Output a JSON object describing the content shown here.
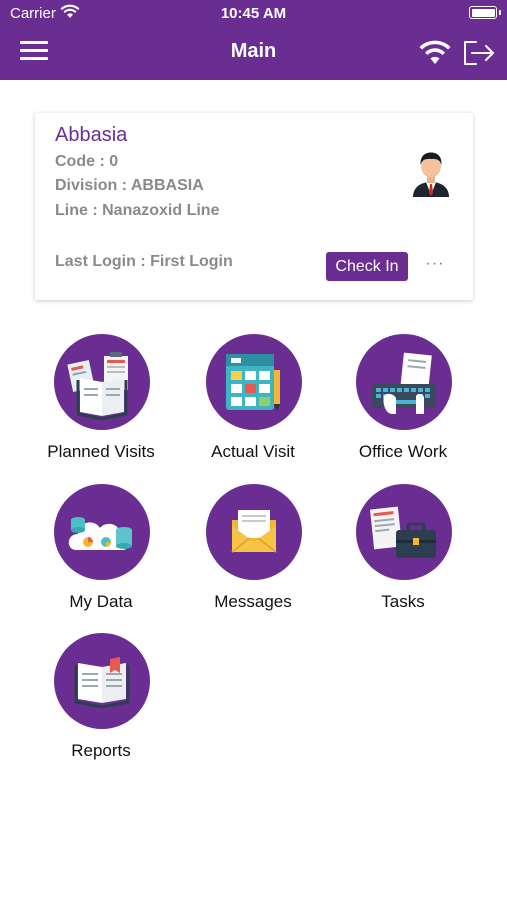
{
  "status_bar": {
    "carrier": "Carrier",
    "time": "10:45 AM"
  },
  "nav": {
    "title": "Main",
    "icons": [
      "menu-icon",
      "wifi-icon",
      "logout-icon"
    ]
  },
  "profile": {
    "name": "Abbasia",
    "code": "Code : 0",
    "division": "Division : ABBASIA",
    "line": "Line : Nanazoxid Line",
    "last_login": "Last Login : First Login",
    "check_in_label": "Check In",
    "more_label": "···",
    "avatar_icon": "businessman-avatar-icon"
  },
  "tiles": [
    {
      "label": "Planned Visits",
      "icon": "planned-visits-icon"
    },
    {
      "label": "Actual Visit",
      "icon": "actual-visit-icon"
    },
    {
      "label": "Office Work",
      "icon": "office-work-icon"
    },
    {
      "label": "My Data",
      "icon": "my-data-icon"
    },
    {
      "label": "Messages",
      "icon": "messages-icon"
    },
    {
      "label": "Tasks",
      "icon": "tasks-icon"
    },
    {
      "label": "Reports",
      "icon": "reports-icon"
    }
  ],
  "colors": {
    "primary": "#6a2e93",
    "label_gray": "#8a8a8a"
  }
}
